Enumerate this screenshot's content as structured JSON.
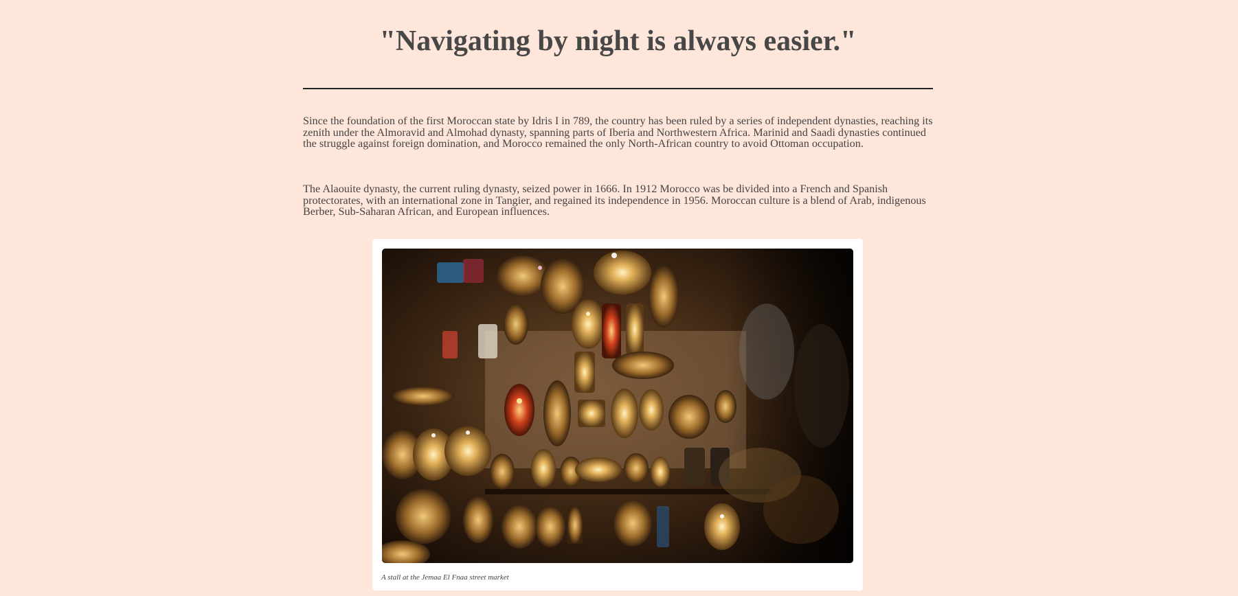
{
  "quote": "\"Navigating by night is always easier.\"",
  "paragraphs": [
    "Since the foundation of the first Moroccan state by Idris I in 789, the country has been ruled by a series of independent dynasties, reaching its zenith under the Almoravid and Almohad dynasty, spanning parts of Iberia and Northwestern Africa. Marinid and Saadi dynasties continued the struggle against foreign domination, and Morocco remained the only North-African country to avoid Ottoman occupation.",
    "The Alaouite dynasty, the current ruling dynasty, seized power in 1666. In 1912 Morocco was be divided into a French and Spanish protectorates, with an international zone in Tangier, and regained its independence in 1956. Moroccan culture is a blend of Arab, indigenous Berber, Sub-Saharan African, and European influences."
  ],
  "figure": {
    "caption": "A stall at the Jemaa El Fnaa street market"
  },
  "colors": {
    "background": "#ffe6da",
    "text": "#444444",
    "card": "#ffffff",
    "rule": "#222222"
  }
}
